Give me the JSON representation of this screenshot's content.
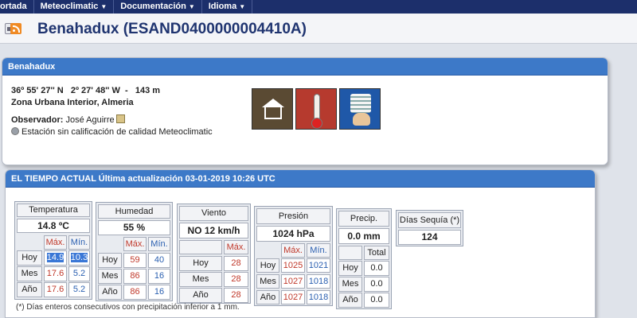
{
  "nav": {
    "items": [
      {
        "label": "ortada",
        "caret": false
      },
      {
        "label": "Meteoclimatic",
        "caret": true
      },
      {
        "label": "Documentación",
        "caret": true
      },
      {
        "label": "Idioma",
        "caret": true
      }
    ]
  },
  "header": {
    "title": "Benahadux (ESAND0400000004410A)",
    "print_icon": "print-icon",
    "rss_icon": "rss-icon"
  },
  "station": {
    "panel_title": "Benahadux",
    "lat": "36º 55' 27'' N",
    "lon": "2º 27' 48'' W",
    "alt": "143 m",
    "zone": "Zona Urbana Interior, Almeria",
    "observer_label": "Observador:",
    "observer_name": "José Aguirre",
    "quality": "Estación sin calificación de calidad Meteoclimatic",
    "icons": [
      "house-icon",
      "thermometer-icon",
      "radiation-shield-icon"
    ]
  },
  "weather": {
    "panel_title": "EL TIEMPO ACTUAL Última actualización 03-01-2019 10:26 UTC",
    "row_labels": [
      "Hoy",
      "Mes",
      "Año"
    ],
    "max_label": "Máx.",
    "min_label": "Mín.",
    "total_label": "Total",
    "temperature": {
      "label": "Temperatura",
      "current": "14.8 ºC",
      "max": [
        "14.9",
        "17.6",
        "17.6"
      ],
      "min": [
        "10.3",
        "5.2",
        "5.2"
      ]
    },
    "humidity": {
      "label": "Humedad",
      "current": "55 %",
      "max": [
        "59",
        "86",
        "86"
      ],
      "min": [
        "40",
        "16",
        "16"
      ]
    },
    "wind": {
      "label": "Viento",
      "current": "NO  12 km/h",
      "max": [
        "28",
        "28",
        "28"
      ]
    },
    "pressure": {
      "label": "Presión",
      "current": "1024 hPa",
      "max": [
        "1025",
        "1027",
        "1027"
      ],
      "min": [
        "1021",
        "1018",
        "1018"
      ]
    },
    "precip": {
      "label": "Precip.",
      "current": "0.0 mm",
      "total": [
        "0.0",
        "0.0",
        "0.0"
      ]
    },
    "drought": {
      "label": "Días Sequía (*)",
      "current": "124"
    },
    "footnote": "(*) Días enteros consecutivos con precipitación inferior a 1 mm."
  },
  "colors": {
    "nav_bg": "#1c2f6b",
    "panel_header": "#3d79c8",
    "max_text": "#c0392b",
    "min_text": "#2a5fb0",
    "highlight": "#3a77d6"
  }
}
